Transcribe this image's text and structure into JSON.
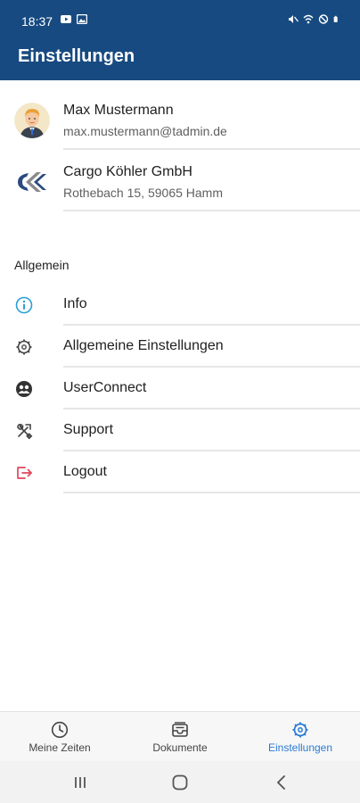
{
  "status_bar": {
    "time": "18:37"
  },
  "header": {
    "title": "Einstellungen"
  },
  "profile": {
    "user": {
      "name": "Max Mustermann",
      "email": "max.mustermann@tadmin.de"
    },
    "company": {
      "name": "Cargo Köhler GmbH",
      "address": "Rothebach 15, 59065 Hamm"
    }
  },
  "section": {
    "label": "Allgemein"
  },
  "menu": {
    "items": [
      {
        "label": "Info",
        "icon": "info-icon",
        "color": "#2a9fd6"
      },
      {
        "label": "Allgemeine Einstellungen",
        "icon": "gear-icon",
        "color": "#444444"
      },
      {
        "label": "UserConnect",
        "icon": "users-icon",
        "color": "#333333"
      },
      {
        "label": "Support",
        "icon": "tools-icon",
        "color": "#444444"
      },
      {
        "label": "Logout",
        "icon": "logout-icon",
        "color": "#e0465a"
      }
    ]
  },
  "bottom_nav": {
    "items": [
      {
        "label": "Meine Zeiten",
        "icon": "clock-icon",
        "active": false
      },
      {
        "label": "Dokumente",
        "icon": "inbox-icon",
        "active": false
      },
      {
        "label": "Einstellungen",
        "icon": "settings-icon",
        "active": true
      }
    ]
  },
  "colors": {
    "header_bg": "#174a80",
    "active_accent": "#2a7bd6",
    "logout_red": "#e0465a",
    "info_blue": "#2a9fd6"
  }
}
